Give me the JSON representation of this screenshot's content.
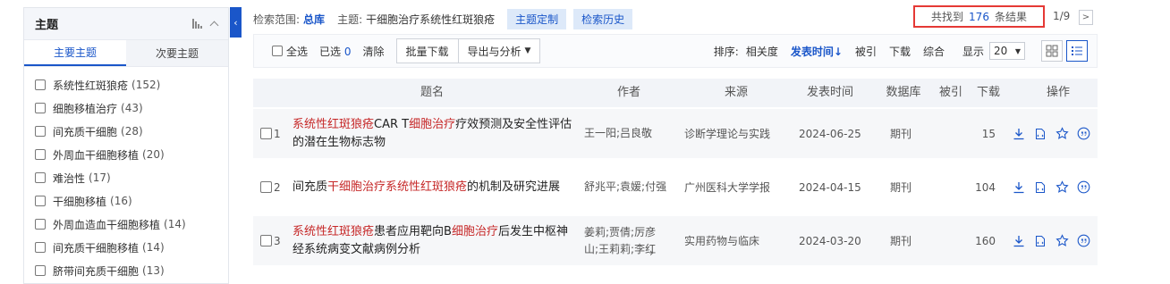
{
  "sidebar": {
    "title": "主题",
    "tabs": [
      {
        "label": "主要主题",
        "active": true
      },
      {
        "label": "次要主题",
        "active": false
      }
    ],
    "facets": [
      {
        "label": "系统性红斑狼疮",
        "count": "(152)"
      },
      {
        "label": "细胞移植治疗",
        "count": "(43)"
      },
      {
        "label": "间充质干细胞",
        "count": "(28)"
      },
      {
        "label": "外周血干细胞移植",
        "count": "(20)"
      },
      {
        "label": "难治性",
        "count": "(17)"
      },
      {
        "label": "干细胞移植",
        "count": "(16)"
      },
      {
        "label": "外周血造血干细胞移植",
        "count": "(14)"
      },
      {
        "label": "间充质干细胞移植",
        "count": "(14)"
      },
      {
        "label": "脐带间充质干细胞",
        "count": "(13)"
      }
    ],
    "collapse_glyph": "‹"
  },
  "search_info": {
    "scope_label": "检索范围:",
    "scope_value": "总库",
    "topic_label": "主题:",
    "topic_value": "干细胞治疗系统性红斑狼疮",
    "custom_button": "主题定制",
    "history_button": "检索历史",
    "found_prefix": "共找到",
    "found_count": "176",
    "found_suffix": "条结果",
    "page_info": "1/9",
    "next_glyph": ">"
  },
  "toolbar": {
    "select_all": "全选",
    "selected_label": "已选",
    "selected_count": "0",
    "clear": "清除",
    "batch_download": "批量下载",
    "export_analysis": "导出与分析",
    "sort_label": "排序:",
    "sort_options": [
      {
        "label": "相关度",
        "active": false
      },
      {
        "label": "发表时间",
        "active": true
      },
      {
        "label": "被引",
        "active": false
      },
      {
        "label": "下载",
        "active": false
      },
      {
        "label": "综合",
        "active": false
      }
    ],
    "sort_arrow": "↓",
    "show_label": "显示",
    "show_value": "20"
  },
  "table": {
    "headers": {
      "title": "题名",
      "author": "作者",
      "source": "来源",
      "date": "发表时间",
      "db": "数据库",
      "cited": "被引",
      "downloads": "下载",
      "ops": "操作"
    },
    "rows": [
      {
        "index": "1",
        "title_parts": [
          {
            "text": "系统性红斑狼疮",
            "hl": true
          },
          {
            "text": "CAR T",
            "hl": false
          },
          {
            "text": "细胞治疗",
            "hl": true
          },
          {
            "text": "疗效预测及安全性评估的潜在生物标志物",
            "hl": false
          }
        ],
        "author": "王一阳;吕良敬",
        "source": "诊断学理论与实践",
        "date": "2024-06-25",
        "db": "期刊",
        "downloads": "15"
      },
      {
        "index": "2",
        "title_parts": [
          {
            "text": "间充质",
            "hl": false
          },
          {
            "text": "干细胞治疗系统性红斑狼疮",
            "hl": true
          },
          {
            "text": "的机制及研究进展",
            "hl": false
          }
        ],
        "author": "舒兆平;袁媛;付强",
        "source": "广州医科大学学报",
        "date": "2024-04-15",
        "db": "期刊",
        "downloads": "104"
      },
      {
        "index": "3",
        "title_parts": [
          {
            "text": "系统性红斑狼疮",
            "hl": true
          },
          {
            "text": "患者应用靶向B",
            "hl": false
          },
          {
            "text": "细胞治疗",
            "hl": true
          },
          {
            "text": "后发生中枢神经系统病变文献病例分析",
            "hl": false
          }
        ],
        "author": "姜莉;贾倩;厉彦山;王莉莉;李红",
        "author_more": "›",
        "source": "实用药物与临床",
        "date": "2024-03-20",
        "db": "期刊",
        "downloads": "160"
      }
    ]
  },
  "colors": {
    "accent": "#1a56c9",
    "highlight": "#c62828",
    "found_border": "#e53935"
  },
  "icons": [
    "bar-chart-icon",
    "collapse-up-icon",
    "download-icon",
    "html-read-icon",
    "favorite-star-icon",
    "quote-icon",
    "grid-view-icon",
    "list-view-icon"
  ]
}
